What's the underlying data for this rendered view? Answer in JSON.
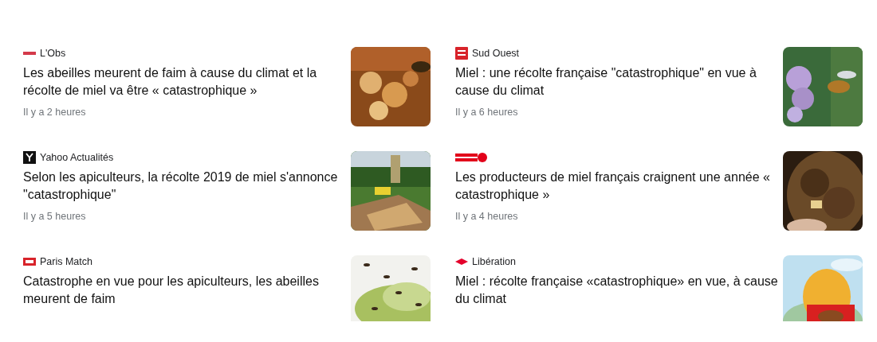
{
  "articles": [
    {
      "source": "L'Obs",
      "kind": "wordmark",
      "headline": "Les abeilles meurent de faim à cause du climat et la récolte de miel va être « catastrophique »",
      "time": "Il y a 2 heures"
    },
    {
      "source": "Sud Ouest",
      "kind": "square",
      "headline": "Miel : une récolte française \"catastrophique\" en vue à cause du climat",
      "time": "Il y a 6 heures"
    },
    {
      "source": "Yahoo Actualités",
      "kind": "dark-square",
      "headline": "Selon les apiculteurs, la récolte 2019 de miel s'annonce \"catastrophique\"",
      "time": "Il y a 5 heures"
    },
    {
      "kind": "round",
      "headline": "Les producteurs de miel français craignent une année « catastrophique »",
      "time": "Il y a 4 heures"
    },
    {
      "source": "Paris Match",
      "kind": "flag",
      "headline": "Catastrophe en vue pour les apiculteurs, les abeilles meurent de faim"
    },
    {
      "source": "Libération",
      "kind": "diamond",
      "headline": "Miel : récolte française «catastrophique» en vue, à cause du climat"
    }
  ]
}
